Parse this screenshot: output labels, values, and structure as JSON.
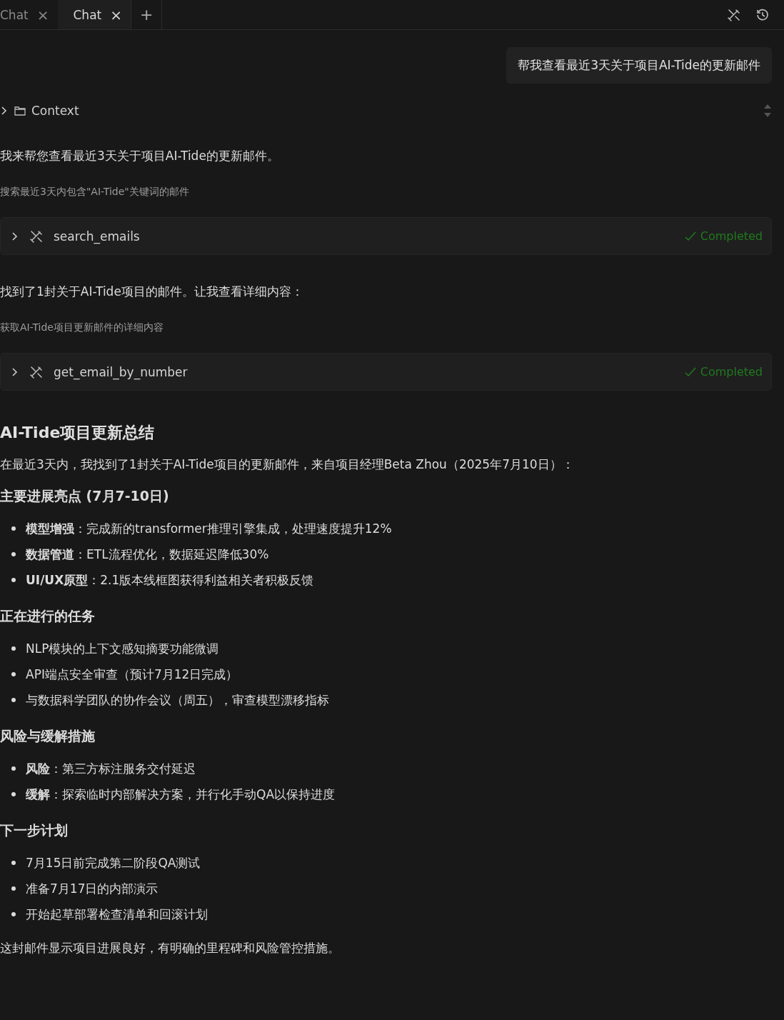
{
  "tabs": [
    {
      "label": "Chat",
      "close": "×",
      "selected": false
    },
    {
      "label": "Chat",
      "close": "×",
      "selected": true
    }
  ],
  "new_tab": "+",
  "user_message": "帮我查看最近3天关于项目AI-Tide的更新邮件",
  "context": {
    "label": "Context",
    "expanded": false
  },
  "messages": [
    {
      "kind": "text",
      "text": "我来帮您查看最近3天关于项目AI-Tide的更新邮件。"
    },
    {
      "kind": "note",
      "text": "搜索最近3天内包含\"AI-Tide\"关键词的邮件"
    },
    {
      "kind": "tool",
      "name": "search_emails",
      "status": "Completed",
      "expanded": false
    },
    {
      "kind": "text",
      "text": "找到了1封关于AI-Tide项目的邮件。让我查看详细内容："
    },
    {
      "kind": "note",
      "text": "获取AI-Tide项目更新邮件的详细内容"
    },
    {
      "kind": "tool",
      "name": "get_email_by_number",
      "status": "Completed",
      "expanded": false
    },
    {
      "kind": "heading",
      "text": "AI-Tide项目更新总结"
    },
    {
      "kind": "paragraph",
      "text": "在最近3天内，我找到了1封关于AI-Tide项目的更新邮件，来自项目经理Beta Zhou（2025年7月10日）："
    },
    {
      "kind": "subheading",
      "text": "主要进展亮点 (7月7-10日)"
    },
    {
      "kind": "bullets",
      "items": [
        "**模型增强**：完成新的transformer推理引擎集成，处理速度提升12%",
        "**数据管道**：ETL流程优化，数据延迟降低30%",
        "**UI/UX原型**：2.1版本线框图获得利益相关者积极反馈"
      ]
    },
    {
      "kind": "subheading",
      "text": "正在进行的任务"
    },
    {
      "kind": "bullets",
      "items": [
        "NLP模块的上下文感知摘要功能微调",
        "API端点安全审查（预计7月12日完成）",
        "与数据科学团队的协作会议（周五），审查模型漂移指标"
      ]
    },
    {
      "kind": "subheading",
      "text": "风险与缓解措施"
    },
    {
      "kind": "bullets",
      "items": [
        "**风险**：第三方标注服务交付延迟",
        "**缓解**：探索临时内部解决方案，并行化手动QA以保持进度"
      ]
    },
    {
      "kind": "subheading",
      "text": "下一步计划"
    },
    {
      "kind": "bullets",
      "items": [
        "7月15日前完成第二阶段QA测试",
        "准备7月17日的内部演示",
        "开始起草部署检查清单和回滚计划"
      ]
    },
    {
      "kind": "paragraph",
      "text": "这封邮件显示项目进展良好，有明确的里程碑和风险管控措施。"
    }
  ]
}
